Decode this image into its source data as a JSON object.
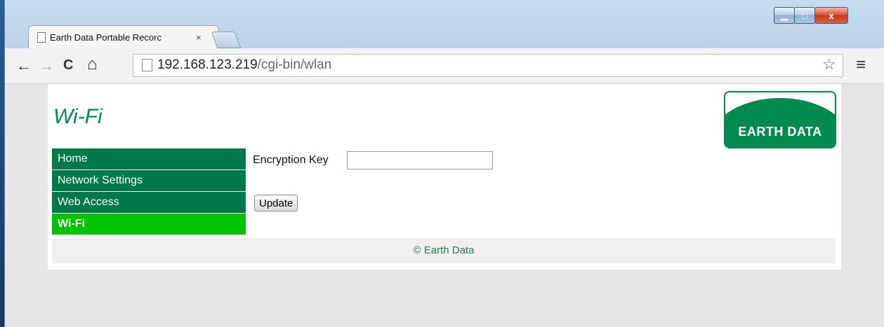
{
  "browser": {
    "tab_title": "Earth Data Portable Recorc",
    "tab_close": "×",
    "url_host": "192.168.123.219",
    "url_path": "/cgi-bin/wlan",
    "back_icon": "←",
    "forward_icon": "→",
    "reload_icon": "C",
    "home_icon": "⌂",
    "star_icon": "☆",
    "menu_icon": "≡",
    "minimize_icon": "▁",
    "maximize_icon": "□",
    "close_icon": "x"
  },
  "page": {
    "title": "Wi-Fi",
    "logo_text": "EARTH DATA",
    "nav": [
      {
        "label": "Home"
      },
      {
        "label": "Network Settings"
      },
      {
        "label": "Web Access"
      },
      {
        "label": "Wi-Fi"
      }
    ],
    "form": {
      "encryption_label": "Encryption Key",
      "encryption_value": "",
      "update_label": "Update"
    },
    "footer": "© Earth Data"
  },
  "colors": {
    "brand_green": "#008a4e",
    "nav_green": "#00784a",
    "active_green": "#00c300"
  }
}
